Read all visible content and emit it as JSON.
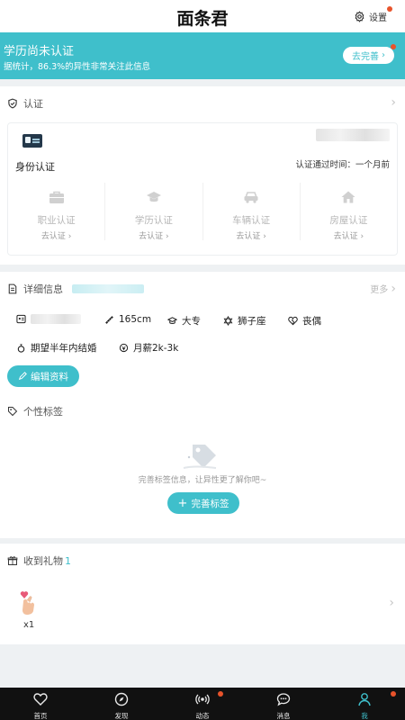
{
  "header": {
    "title": "面条君",
    "settings_label": "设置"
  },
  "banner": {
    "title": "学历尚未认证",
    "subtitle": "据统计，86.3%的异性非常关注此信息",
    "button_label": "去完善",
    "accent": "#3fbfcb"
  },
  "verify": {
    "section_title": "认证",
    "identity_label": "身份认证",
    "time_text": "认证通过时间：一个月前",
    "items": [
      {
        "name": "职业认证",
        "action": "去认证",
        "icon": "briefcase-icon"
      },
      {
        "name": "学历认证",
        "action": "去认证",
        "icon": "graduation-cap-icon"
      },
      {
        "name": "车辆认证",
        "action": "去认证",
        "icon": "car-icon"
      },
      {
        "name": "房屋认证",
        "action": "去认证",
        "icon": "house-icon"
      }
    ]
  },
  "details": {
    "section_title": "详细信息",
    "more_label": "更多",
    "height": "165cm",
    "education": "大专",
    "zodiac": "狮子座",
    "marital": "丧偶",
    "marriage_plan": "期望半年内结婚",
    "salary": "月薪2k-3k",
    "edit_label": "编辑资料"
  },
  "tags": {
    "section_title": "个性标签",
    "empty_text": "完善标签信息，让异性更了解你吧~",
    "button_label": "完善标签"
  },
  "gifts": {
    "section_title": "收到礼物",
    "count": "1",
    "item_count": "x1"
  },
  "nav": [
    {
      "label": "首页",
      "icon": "heart-icon"
    },
    {
      "label": "发现",
      "icon": "compass-icon"
    },
    {
      "label": "动态",
      "icon": "broadcast-icon"
    },
    {
      "label": "消息",
      "icon": "chat-icon"
    },
    {
      "label": "我",
      "icon": "person-icon"
    }
  ]
}
